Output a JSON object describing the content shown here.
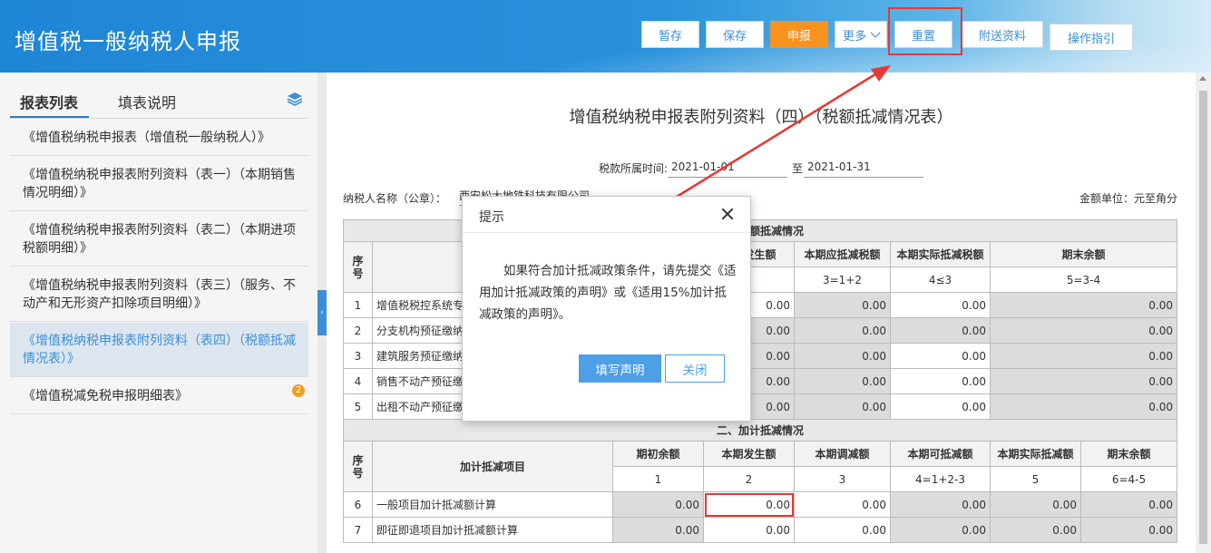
{
  "header": {
    "title": "增值税一般纳税人申报",
    "buttons": {
      "temp_save": "暂存",
      "save": "保存",
      "declare": "申报",
      "more": "更多",
      "reset": "重置",
      "attach": "附送资料",
      "guide": "操作指引"
    }
  },
  "sidebar": {
    "tab_list": "报表列表",
    "tab_help": "填表说明",
    "items": [
      {
        "label": "《增值税纳税申报表（增值税一般纳税人）》"
      },
      {
        "label": "《增值税纳税申报表附列资料（表一）（本期销售情况明细）》"
      },
      {
        "label": "《增值税纳税申报表附列资料（表二）（本期进项税额明细）》"
      },
      {
        "label": "《增值税纳税申报表附列资料（表三）（服务、不动产和无形资产扣除项目明细）》"
      },
      {
        "label": "《增值税纳税申报表附列资料（表四）（税额抵减情况表）》"
      },
      {
        "label": "《增值税减免税申报明细表》",
        "badge": "2"
      }
    ]
  },
  "form": {
    "title": "增值税纳税申报表附列资料（四）（税额抵减情况表）",
    "period_label": "税款所属时间:",
    "period_start": "2021-01-01",
    "period_to": "至",
    "period_end": "2021-01-31",
    "taxpayer_label": "纳税人名称（公章）：",
    "taxpayer_value": "西安松大地铁科技有限公司",
    "unit_label": "金额单位：元至角分",
    "section1": "一、税额抵减情况",
    "section1_headers": {
      "seq": "序号",
      "c2": "本期发生额",
      "c3": "本期应抵减税额",
      "c4": "本期实际抵减税额",
      "c5": "期末余额",
      "f3": "3=1+2",
      "f4": "4≤3",
      "f5": "5=3-4"
    },
    "section1_rows": [
      {
        "seq": "1",
        "item": "增值税税控系统专用设备费及技术维护费",
        "v2": "0.00",
        "v3": "0.00",
        "v4": "0.00",
        "v5": "0.00"
      },
      {
        "seq": "2",
        "item": "分支机构预征缴纳税款",
        "v2": "0.00",
        "v3": "0.00",
        "v4": "0.00",
        "v5": "0.00"
      },
      {
        "seq": "3",
        "item": "建筑服务预征缴纳税款",
        "v2": "0.00",
        "v3": "0.00",
        "v4": "0.00",
        "v5": "0.00"
      },
      {
        "seq": "4",
        "item": "销售不动产预征缴纳税款",
        "v2": "0.00",
        "v3": "0.00",
        "v4": "0.00",
        "v5": "0.00"
      },
      {
        "seq": "5",
        "item": "出租不动产预征缴纳税款",
        "v2": "0.00",
        "v3": "0.00",
        "v4": "0.00",
        "v5": "0.00"
      }
    ],
    "section2": "二、加计抵减情况",
    "section2_headers": {
      "seq": "序号",
      "item": "加计抵减项目",
      "c1": "期初余额",
      "c2": "本期发生额",
      "c3": "本期调减额",
      "c4": "本期可抵减额",
      "c5": "本期实际抵减额",
      "c6": "期末余额",
      "f1": "1",
      "f2": "2",
      "f3": "3",
      "f4": "4=1+2-3",
      "f5": "5",
      "f6": "6=4-5"
    },
    "section2_rows": [
      {
        "seq": "6",
        "item": "一般项目加计抵减额计算",
        "v1": "0.00",
        "v2": "0.00",
        "v3": "0.00",
        "v4": "0.00",
        "v5": "0.00",
        "v6": "0.00"
      },
      {
        "seq": "7",
        "item": "即征即退项目加计抵减额计算",
        "v1": "0.00",
        "v2": "0.00",
        "v3": "0.00",
        "v4": "0.00",
        "v5": "0.00",
        "v6": "0.00"
      }
    ]
  },
  "dialog": {
    "title": "提示",
    "message": "如果符合加计抵减政策条件，请先提交《适用加计抵减政策的声明》或《适用15%加计抵减政策的声明》。",
    "primary_button": "填写声明",
    "secondary_button": "关闭"
  },
  "colors": {
    "header_blue": "#1e86d6",
    "accent_orange": "#f7931e",
    "link_blue": "#3a8fd8",
    "highlight_red": "#e53935"
  }
}
